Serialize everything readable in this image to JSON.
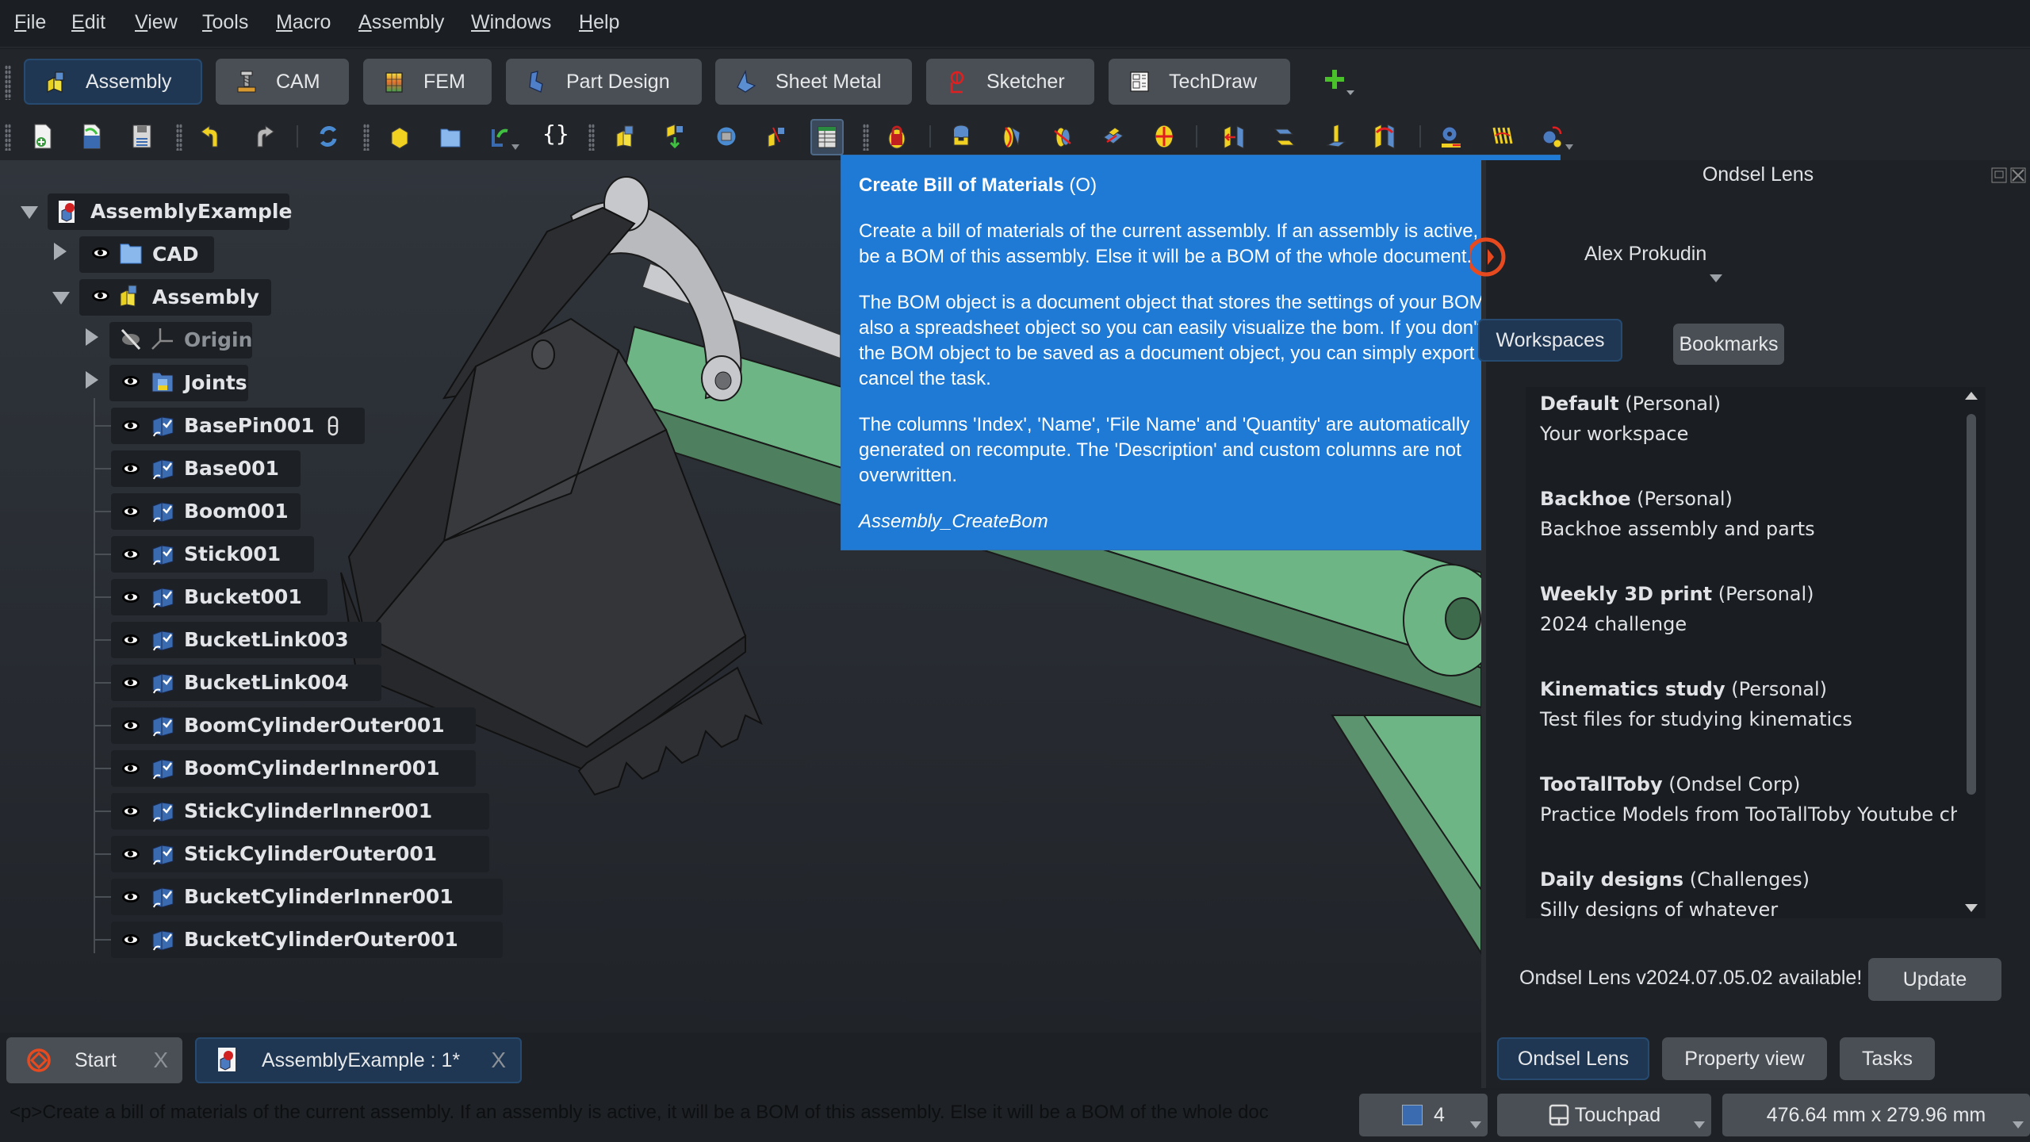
{
  "menu": [
    "File",
    "Edit",
    "View",
    "Tools",
    "Macro",
    "Assembly",
    "Windows",
    "Help"
  ],
  "workbenches": [
    {
      "label": "Assembly",
      "icon": "assembly-workbench-icon",
      "active": true
    },
    {
      "label": "CAM",
      "icon": "cam-workbench-icon",
      "active": false
    },
    {
      "label": "FEM",
      "icon": "fem-workbench-icon",
      "active": false
    },
    {
      "label": "Part Design",
      "icon": "part-design-workbench-icon",
      "active": false
    },
    {
      "label": "Sheet Metal",
      "icon": "sheet-metal-workbench-icon",
      "active": false
    },
    {
      "label": "Sketcher",
      "icon": "sketcher-workbench-icon",
      "active": false
    },
    {
      "label": "TechDraw",
      "icon": "techdraw-workbench-icon",
      "active": false
    }
  ],
  "add_workbench_label": "+",
  "toolbar_icons": [
    "new-document-icon",
    "open-document-icon",
    "save-document-icon",
    "undo-icon",
    "redo-icon",
    "refresh-icon",
    "part-icon",
    "group-folder-icon",
    "link-icon",
    "expression-braces-icon",
    "create-assembly-icon",
    "insert-component-icon",
    "solve-assembly-icon",
    "exploded-view-icon",
    "create-bom-icon",
    "ground-joint-icon",
    "fixed-joint-icon",
    "revolute-joint-icon",
    "cylindrical-joint-icon",
    "slider-joint-icon",
    "ball-joint-icon",
    "distance-joint-icon",
    "parallel-joint-icon",
    "perpendicular-joint-icon",
    "angle-joint-icon",
    "rack-pinion-icon",
    "screw-joint-icon",
    "gears-belt-icon"
  ],
  "tree": {
    "root": "AssemblyExample",
    "items": [
      {
        "label": "CAD",
        "level": 1,
        "expander": "collapsed",
        "icon": "folder-icon",
        "visible": true
      },
      {
        "label": "Assembly",
        "level": 1,
        "expander": "expanded",
        "icon": "assembly-icon",
        "visible": true
      },
      {
        "label": "Origin",
        "level": 2,
        "expander": "collapsed",
        "icon": "origin-axes-icon",
        "visible": false
      },
      {
        "label": "Joints",
        "level": 2,
        "expander": "collapsed",
        "icon": "joints-folder-icon",
        "visible": true
      },
      {
        "label": "BasePin001",
        "level": 2,
        "icon": "linked-part-icon",
        "visible": true,
        "badge": "grounded-pin-icon"
      },
      {
        "label": "Base001",
        "level": 2,
        "icon": "linked-part-icon",
        "visible": true
      },
      {
        "label": "Boom001",
        "level": 2,
        "icon": "linked-part-icon",
        "visible": true
      },
      {
        "label": "Stick001",
        "level": 2,
        "icon": "linked-part-icon",
        "visible": true
      },
      {
        "label": "Bucket001",
        "level": 2,
        "icon": "linked-part-icon",
        "visible": true
      },
      {
        "label": "BucketLink003",
        "level": 2,
        "icon": "linked-part-icon",
        "visible": true
      },
      {
        "label": "BucketLink004",
        "level": 2,
        "icon": "linked-part-icon",
        "visible": true
      },
      {
        "label": "BoomCylinderOuter001",
        "level": 2,
        "icon": "linked-part-icon",
        "visible": true
      },
      {
        "label": "BoomCylinderInner001",
        "level": 2,
        "icon": "linked-part-icon",
        "visible": true
      },
      {
        "label": "StickCylinderInner001",
        "level": 2,
        "icon": "linked-part-icon",
        "visible": true
      },
      {
        "label": "StickCylinderOuter001",
        "level": 2,
        "icon": "linked-part-icon",
        "visible": true
      },
      {
        "label": "BucketCylinderInner001",
        "level": 2,
        "icon": "linked-part-icon",
        "visible": true
      },
      {
        "label": "BucketCylinderOuter001",
        "level": 2,
        "icon": "linked-part-icon",
        "visible": true
      }
    ]
  },
  "tooltip": {
    "title": "Create Bill of Materials",
    "shortcut": "(O)",
    "paragraphs": [
      "Create a bill of materials of the current assembly. If an assembly is active, it will be a BOM of this assembly. Else it will be a BOM of the whole document.",
      "The BOM object is a document object that stores the settings of your BOM. It is also a spreadsheet object so you can easily visualize the bom. If you don't need the BOM object to be saved as a document object, you can simply export and cancel the task.",
      "The columns 'Index', 'Name', 'File Name' and 'Quantity' are automatically generated on recompute. The 'Description' and custom columns are not overwritten."
    ],
    "command": "Assembly_CreateBom"
  },
  "right_panel": {
    "title": "Ondsel Lens",
    "user": "Alex Prokudin",
    "tabs": [
      "Workspaces",
      "Bookmarks"
    ],
    "active_tab": "Workspaces",
    "workspaces": [
      {
        "name": "Default",
        "owner": "(Personal)",
        "desc": "Your workspace"
      },
      {
        "name": "Backhoe",
        "owner": "(Personal)",
        "desc": "Backhoe assembly and parts"
      },
      {
        "name": "Weekly 3D print",
        "owner": "(Personal)",
        "desc": "2024 challenge"
      },
      {
        "name": "Kinematics study",
        "owner": "(Personal)",
        "desc": "Test files for studying kinematics"
      },
      {
        "name": "TooTallToby",
        "owner": "(Ondsel Corp)",
        "desc": "Practice Models from TooTallToby Youtube channel"
      },
      {
        "name": "Daily designs",
        "owner": "(Challenges)",
        "desc": "Silly designs of whatever"
      }
    ],
    "update_message": "Ondsel Lens v2024.07.05.02 available!",
    "update_button": "Update",
    "bottom_tabs": [
      "Ondsel Lens",
      "Property view",
      "Tasks"
    ],
    "active_bottom_tab": "Ondsel Lens"
  },
  "doc_tabs": [
    {
      "label": "Start",
      "icon": "ondsel-start-icon",
      "active": false
    },
    {
      "label": "AssemblyExample : 1*",
      "icon": "assembly-document-icon",
      "active": true
    }
  ],
  "close_glyph": "X",
  "status": {
    "message": "<p>Create a bill of materials of the current assembly. If an assembly is active, it will be a BOM of this assembly. Else it will be a BOM of the whole doc",
    "draw_style_value": "4",
    "navigation": "Touchpad",
    "dimensions": "476.64 mm x 279.96 mm"
  },
  "colors": {
    "accent_blue": "#1e7ad4",
    "active_tab_bg": "#1f3753",
    "model_green": "#6db584",
    "model_dark": "#3a3c3f",
    "model_grey": "#b8babd"
  }
}
